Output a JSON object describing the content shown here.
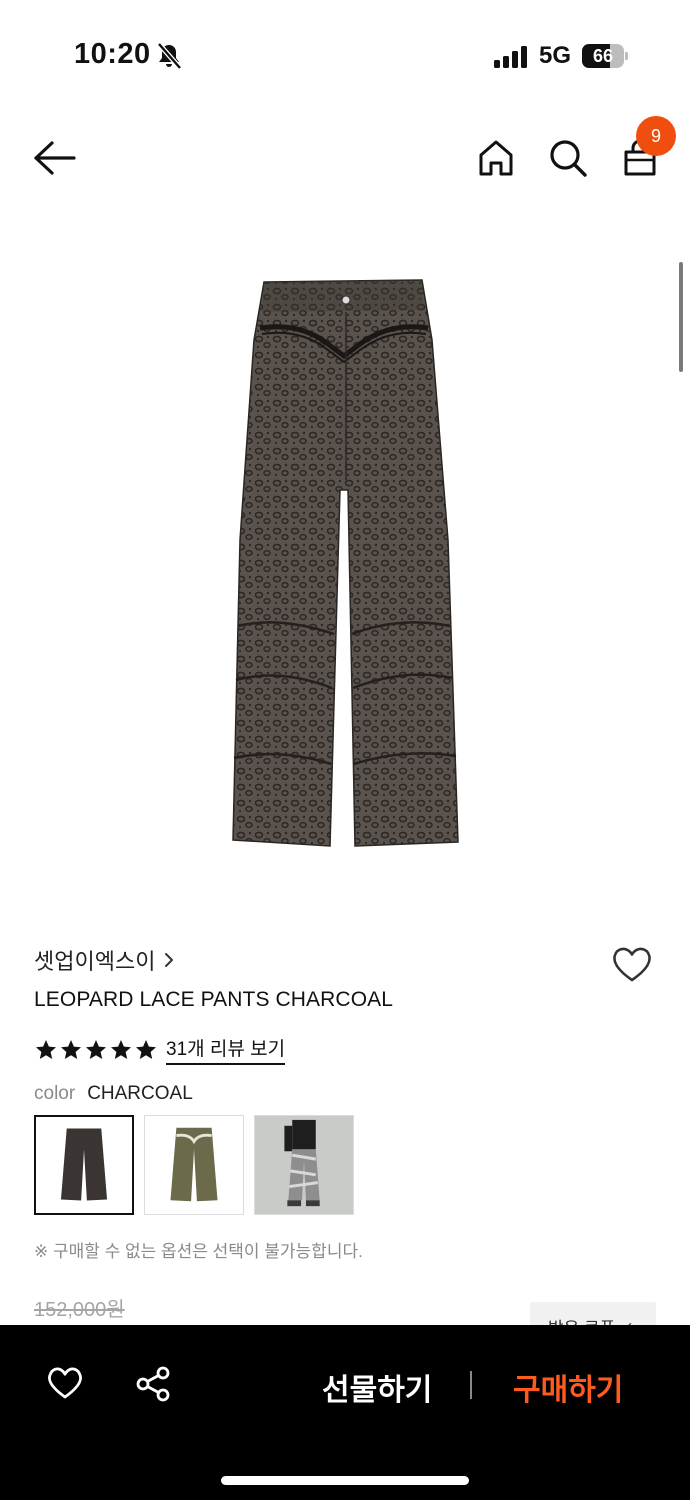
{
  "status_bar": {
    "time": "10:20",
    "network": "5G",
    "battery_level": 66,
    "battery_text": "66",
    "icons": [
      "bell-slash-icon",
      "signal-icon",
      "battery-icon"
    ]
  },
  "header": {
    "icons": [
      "arrow-left-icon",
      "home-icon",
      "search-icon",
      "shopping-bag-icon"
    ],
    "cart_count": "9"
  },
  "product": {
    "brand": "셋업이엑스이",
    "title": "LEOPARD LACE PANTS CHARCOAL",
    "rating_stars": 5,
    "review_link": "31개 리뷰 보기",
    "option_label": "color",
    "option_value": "CHARCOAL",
    "swatches": [
      {
        "color": "#3a3532",
        "selected": true
      },
      {
        "color": "#6b6a4a",
        "selected": false
      },
      {
        "color": "#b8b8b8",
        "selected": false
      }
    ],
    "notice": "※ 구매할 수 없는 옵션은 선택이 불가능합니다.",
    "original_price": "152,000원",
    "coupon_label": "받은 쿠폰 ✓"
  },
  "bottom_bar": {
    "gift_label": "선물하기",
    "buy_label": "구매하기",
    "accent_color": "#ff5a1f"
  },
  "colors": {
    "badge": "#f04e0f",
    "fabric": "#3d3835"
  }
}
